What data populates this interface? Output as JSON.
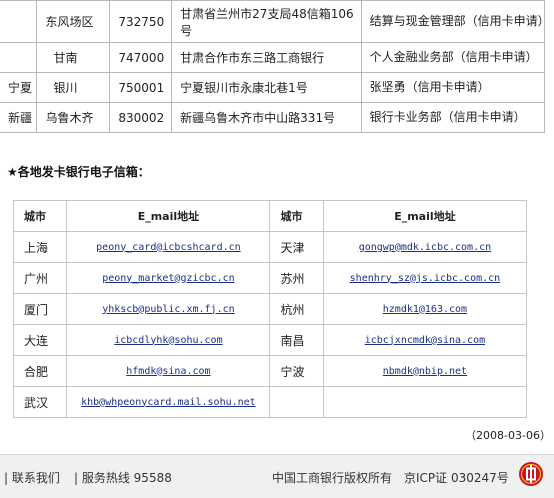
{
  "branch_rows": [
    {
      "province": "",
      "city": "东风场区",
      "postcode": "732750",
      "address": "甘肃省兰州市27支局48信箱106号",
      "department": "结算与现金管理部（信用卡申请）"
    },
    {
      "province": "",
      "city": "甘南",
      "postcode": "747000",
      "address": "甘肃合作市东三路工商银行",
      "department": "个人金融业务部（信用卡申请）"
    },
    {
      "province": "宁夏",
      "city": "银川",
      "postcode": "750001",
      "address": "宁夏银川市永康北巷1号",
      "department": "张坚勇（信用卡申请）"
    },
    {
      "province": "新疆",
      "city": "乌鲁木齐",
      "postcode": "830002",
      "address": "新疆乌鲁木齐市中山路331号",
      "department": "银行卡业务部（信用卡申请）"
    }
  ],
  "heading": "★各地发卡银行电子信箱：",
  "email_table": {
    "headers": {
      "city": "城市",
      "email": "E_mail地址"
    },
    "rows": [
      {
        "city_left": "上海",
        "email_left": "peony_card@icbcshcard.cn",
        "city_right": "天津",
        "email_right": "gongwp@mdk.icbc.com.cn"
      },
      {
        "city_left": "广州",
        "email_left": "peony_market@gzicbc.cn",
        "city_right": "苏州",
        "email_right": "shenhry_sz@js.icbc.com.cn"
      },
      {
        "city_left": "厦门",
        "email_left": "yhkscb@public.xm.fj.cn",
        "city_right": "杭州",
        "email_right": "hzmdk1@163.com"
      },
      {
        "city_left": "大连",
        "email_left": "icbcdlyhk@sohu.com",
        "city_right": "南昌",
        "email_right": "icbcjxncmdk@sina.com"
      },
      {
        "city_left": "合肥",
        "email_left": "hfmdk@sina.com",
        "city_right": "宁波",
        "email_right": "nbmdk@nbip.net"
      },
      {
        "city_left": "武汉",
        "email_left": "khb@whpeonycard.mail.sohu.net",
        "city_right": "",
        "email_right": ""
      }
    ]
  },
  "date": "（2008-03-06）",
  "footer": {
    "contact": "| 联系我们",
    "hotline": "| 服务热线 95588",
    "copyright": "中国工商银行版权所有",
    "icp": "京ICP证 030247号",
    "logo_icon": "icbc-logo-icon",
    "logo_color": "#c8102e"
  }
}
